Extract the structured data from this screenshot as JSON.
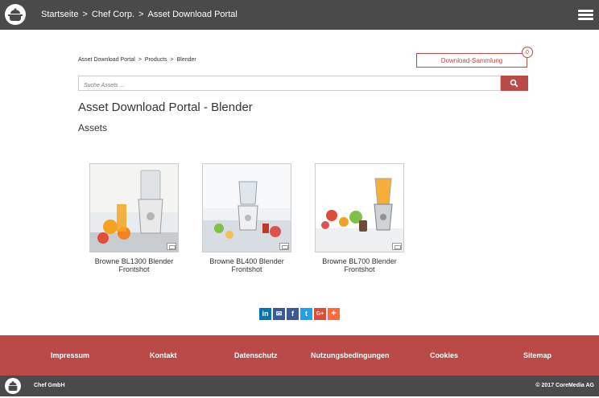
{
  "topbar": {
    "breadcrumb": [
      "Startseite",
      "Chef Corp.",
      "Asset Download Portal"
    ],
    "separator": ">",
    "logo_icon": "chef-pot-icon",
    "menu_icon": "hamburger-icon"
  },
  "page": {
    "breadcrumb": [
      "Asset Download Portal",
      "Products",
      "Blender"
    ],
    "separator": ">",
    "download_button": "Download-Sammlung",
    "download_count": "0",
    "search_placeholder": "Suche Assets ...",
    "search_icon": "search-icon",
    "title": "Asset Download Portal - Blender",
    "subtitle": "Assets"
  },
  "assets": [
    {
      "name": "Browne BL1300 Blender Frontshot",
      "icon": "image-type-icon"
    },
    {
      "name": "Browne BL400 Blender Frontshot",
      "icon": "image-type-icon"
    },
    {
      "name": "Browne BL700 Blender Frontshot",
      "icon": "image-type-icon"
    }
  ],
  "share": [
    {
      "label": "in",
      "icon": "linkedin-icon",
      "color": "#0077b5"
    },
    {
      "label": "✉",
      "icon": "email-icon",
      "color": "#3b5998"
    },
    {
      "label": "f",
      "icon": "facebook-icon",
      "color": "#3b5998"
    },
    {
      "label": "t",
      "icon": "twitter-icon",
      "color": "#1da1f2"
    },
    {
      "label": "G+",
      "icon": "google-plus-icon",
      "color": "#dd4b39"
    },
    {
      "label": "+",
      "icon": "add-more-icon",
      "color": "#ff6a36"
    }
  ],
  "footer": {
    "links": [
      "Impressum",
      "Kontakt",
      "Datenschutz",
      "Nutzungsbedingungen",
      "Cookies",
      "Sitemap"
    ]
  },
  "bottombar": {
    "company": "Chef GmbH",
    "copyright": "© 2017 CoreMedia AG"
  },
  "colors": {
    "accent": "#b94a48",
    "dark": "#4a4a4a"
  }
}
